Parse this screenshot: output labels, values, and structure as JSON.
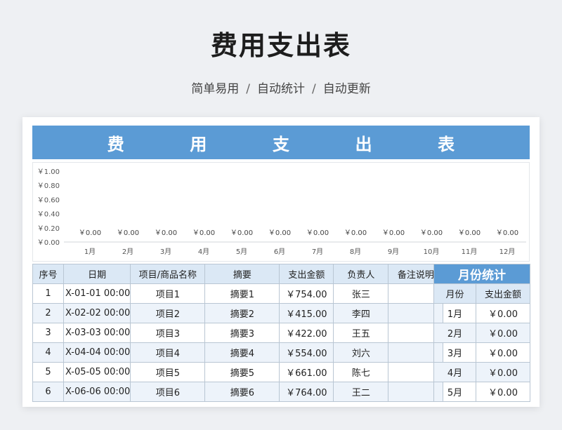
{
  "page": {
    "title": "费用支出表",
    "subtitle_parts": [
      "简单易用",
      "自动统计",
      "自动更新"
    ],
    "separator": "/"
  },
  "sheet": {
    "banner_chars": [
      "费",
      "用",
      "支",
      "出",
      "表"
    ],
    "columns": [
      "序号",
      "日期",
      "项目/商品名称",
      "摘要",
      "支出金额",
      "负责人",
      "备注说明"
    ],
    "rows": [
      {
        "no": "1",
        "date": "X-01-01 00:00",
        "item": "项目1",
        "summary": "摘要1",
        "amount": "￥754.00",
        "owner": "张三",
        "note": ""
      },
      {
        "no": "2",
        "date": "X-02-02 00:00",
        "item": "项目2",
        "summary": "摘要2",
        "amount": "￥415.00",
        "owner": "李四",
        "note": ""
      },
      {
        "no": "3",
        "date": "X-03-03 00:00",
        "item": "项目3",
        "summary": "摘要3",
        "amount": "￥422.00",
        "owner": "王五",
        "note": ""
      },
      {
        "no": "4",
        "date": "X-04-04 00:00",
        "item": "项目4",
        "summary": "摘要4",
        "amount": "￥554.00",
        "owner": "刘六",
        "note": ""
      },
      {
        "no": "5",
        "date": "X-05-05 00:00",
        "item": "项目5",
        "summary": "摘要5",
        "amount": "￥661.00",
        "owner": "陈七",
        "note": ""
      },
      {
        "no": "6",
        "date": "X-06-06 00:00",
        "item": "项目6",
        "summary": "摘要6",
        "amount": "￥764.00",
        "owner": "王二",
        "note": ""
      }
    ],
    "monthly": {
      "title": "月份统计",
      "columns": [
        "月份",
        "支出金额"
      ],
      "rows": [
        {
          "month": "1月",
          "amount": "￥0.00"
        },
        {
          "month": "2月",
          "amount": "￥0.00"
        },
        {
          "month": "3月",
          "amount": "￥0.00"
        },
        {
          "month": "4月",
          "amount": "￥0.00"
        },
        {
          "month": "5月",
          "amount": "￥0.00"
        }
      ]
    }
  },
  "chart_data": {
    "type": "bar",
    "categories": [
      "1月",
      "2月",
      "3月",
      "4月",
      "5月",
      "6月",
      "7月",
      "8月",
      "9月",
      "10月",
      "11月",
      "12月"
    ],
    "values": [
      0,
      0,
      0,
      0,
      0,
      0,
      0,
      0,
      0,
      0,
      0,
      0
    ],
    "data_labels": [
      "￥0.00",
      "￥0.00",
      "￥0.00",
      "￥0.00",
      "￥0.00",
      "￥0.00",
      "￥0.00",
      "￥0.00",
      "￥0.00",
      "￥0.00",
      "￥0.00",
      "￥0.00"
    ],
    "y_ticks": [
      "￥0.00",
      "￥0.20",
      "￥0.40",
      "￥0.60",
      "￥0.80",
      "￥1.00"
    ],
    "ylim": [
      0,
      1
    ],
    "grid": false,
    "bar_color": "#5b9bd5"
  }
}
